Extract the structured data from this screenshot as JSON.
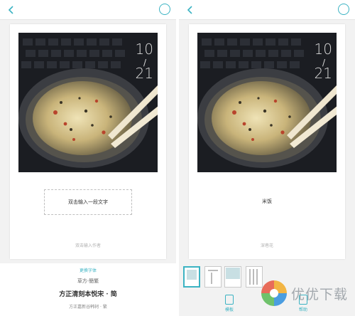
{
  "left": {
    "date_day": "10",
    "date_month": "21",
    "text_placeholder": "双击输入一段文字",
    "author_placeholder": "双击输入作者",
    "change_font_label": "更换字体",
    "fonts": [
      "草方-簡繁",
      "方正清刻本悦宋 · 简",
      "方正嘉新谷韩轲 · 繁"
    ]
  },
  "right": {
    "date_day": "10",
    "date_month": "21",
    "text": "米饭",
    "author": "深巷花",
    "toolbar": {
      "template_label": "模板",
      "help_label": "帮助"
    },
    "watermark_text": "优优下载"
  },
  "colors": {
    "accent": "#3bb3c3"
  },
  "icons": [
    "back-arrow-icon",
    "circle-icon",
    "template-icon",
    "help-icon",
    "site-logo-icon"
  ]
}
